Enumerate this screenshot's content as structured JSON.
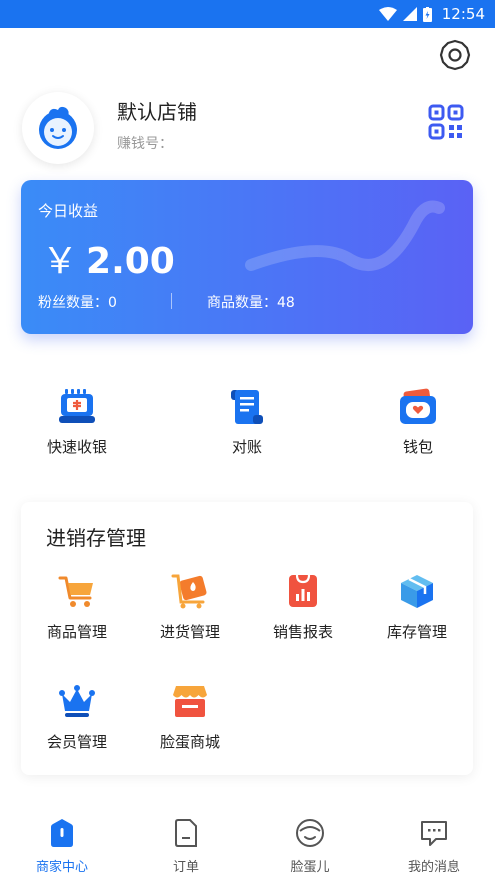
{
  "status_bar": {
    "time": "12:54"
  },
  "profile": {
    "store_name": "默认店铺",
    "earn_label": "赚钱号："
  },
  "income_card": {
    "title": "今日收益",
    "currency": "￥",
    "amount": "2.00",
    "fans": "粉丝数量：0",
    "goods": "商品数量：48"
  },
  "quick_actions": [
    {
      "label": "快速收银",
      "icon": "cashier-icon"
    },
    {
      "label": "对账",
      "icon": "bill-icon"
    },
    {
      "label": "钱包",
      "icon": "wallet-icon"
    }
  ],
  "inventory": {
    "title": "进销存管理",
    "items": [
      {
        "label": "商品管理",
        "icon": "cart-icon"
      },
      {
        "label": "进货管理",
        "icon": "purchase-icon"
      },
      {
        "label": "销售报表",
        "icon": "sales-report-icon"
      },
      {
        "label": "库存管理",
        "icon": "box-icon"
      },
      {
        "label": "会员管理",
        "icon": "crown-icon"
      },
      {
        "label": "脸蛋商城",
        "icon": "store-icon"
      }
    ]
  },
  "tabbar": {
    "items": [
      {
        "label": "商家中心",
        "icon": "home-icon",
        "active": true
      },
      {
        "label": "订单",
        "icon": "order-icon",
        "active": false
      },
      {
        "label": "脸蛋儿",
        "icon": "face-icon",
        "active": false
      },
      {
        "label": "我的消息",
        "icon": "message-icon",
        "active": false
      }
    ]
  },
  "colors": {
    "primary": "#1a73f0",
    "card_start": "#3a8cf7",
    "card_end": "#5a62f5"
  }
}
